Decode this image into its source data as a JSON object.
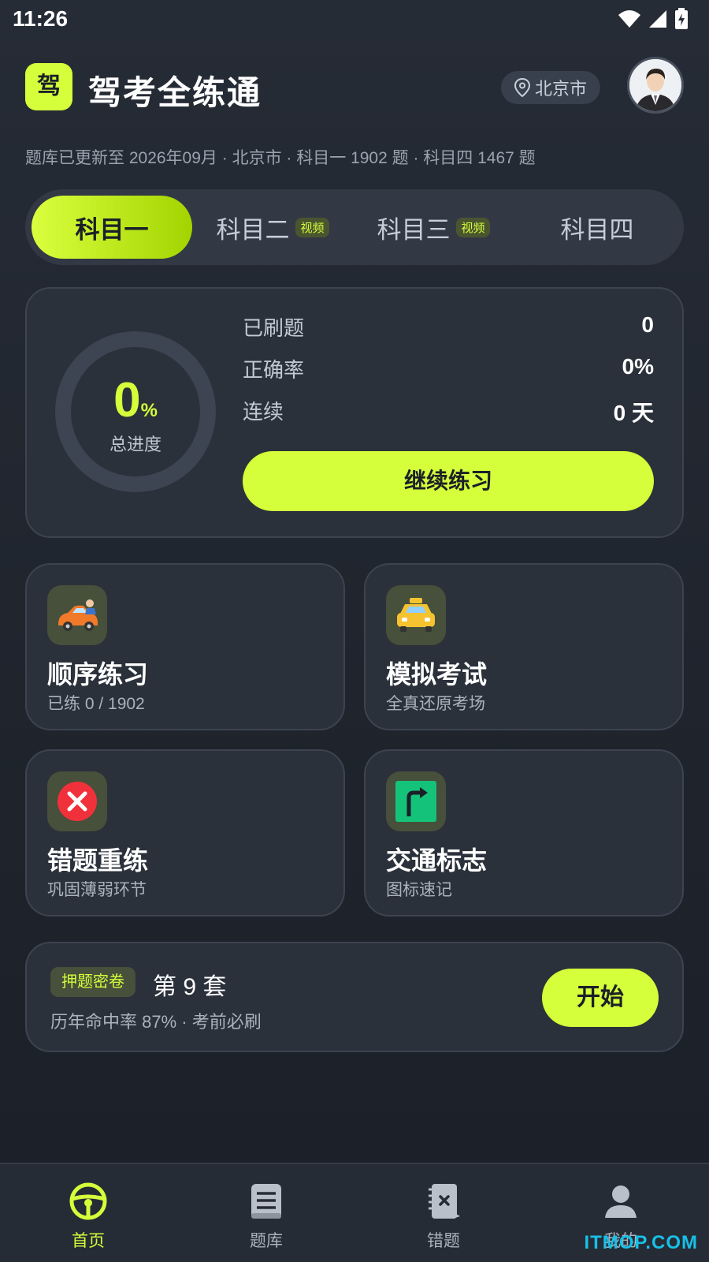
{
  "status": {
    "time": "11:26"
  },
  "header": {
    "logo_char": "驾",
    "title": "驾考全练通",
    "city": "北京市"
  },
  "update_line": "题库已更新至 2026年09月 · 北京市 · 科目一 1902 题 · 科目四 1467 题",
  "tabs": [
    {
      "label": "科目一",
      "badge": "",
      "active": true
    },
    {
      "label": "科目二",
      "badge": "视频",
      "active": false
    },
    {
      "label": "科目三",
      "badge": "视频",
      "active": false
    },
    {
      "label": "科目四",
      "badge": "",
      "active": false
    }
  ],
  "progress": {
    "value": "0",
    "unit": "%",
    "label": "总进度",
    "fraction": 0,
    "stats": [
      {
        "label": "已刷题",
        "value": "0"
      },
      {
        "label": "正确率",
        "value": "0%"
      },
      {
        "label": "连续",
        "value": "0 天"
      }
    ],
    "continue_label": "继续练习"
  },
  "features": [
    {
      "title": "顺序练习",
      "subtitle": "已练 0 / 1902",
      "icon": "car-icon"
    },
    {
      "title": "模拟考试",
      "subtitle": "全真还原考场",
      "icon": "taxi-icon"
    },
    {
      "title": "错题重练",
      "subtitle": "巩固薄弱环节",
      "icon": "wrong-cross-icon"
    },
    {
      "title": "交通标志",
      "subtitle": "图标速记",
      "icon": "traffic-sign-icon"
    }
  ],
  "promo": {
    "tag": "押题密卷",
    "title": "第 9 套",
    "subtitle": "历年命中率 87% · 考前必刷",
    "button": "开始"
  },
  "nav": [
    {
      "label": "首页",
      "icon": "steering-wheel-icon",
      "active": true
    },
    {
      "label": "题库",
      "icon": "question-bank-icon",
      "active": false
    },
    {
      "label": "错题",
      "icon": "mistake-book-icon",
      "active": false
    },
    {
      "label": "我的",
      "icon": "profile-icon",
      "active": false
    }
  ],
  "colors": {
    "accent": "#d4ff3a",
    "background": "#1f242d",
    "card": "#2b313b"
  },
  "watermark": "ITMOP.COM"
}
